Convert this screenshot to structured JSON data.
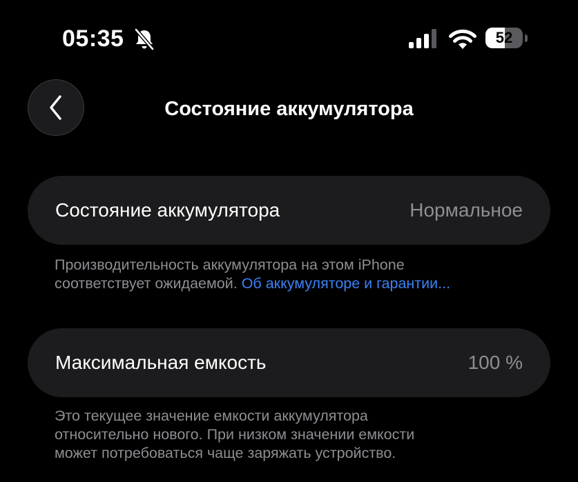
{
  "status_bar": {
    "time": "05:35",
    "battery_percent": "52",
    "battery_level": 0.52,
    "icons": [
      "bell-slash-icon",
      "cellular-signal-icon",
      "wifi-icon",
      "battery-icon"
    ]
  },
  "nav": {
    "title": "Состояние аккумулятора",
    "back_icon": "chevron-left-icon"
  },
  "battery_health": {
    "label": "Состояние аккумулятора",
    "value": "Нормальное",
    "footnote_line1": "Производительность аккумулятора на этом iPhone",
    "footnote_line2": "соответствует ожидаемой.",
    "footnote_link": "Об аккумуляторе и гарантии..."
  },
  "max_capacity": {
    "label": "Максимальная емкость",
    "value": "100 %",
    "footnote_line1": "Это текущее значение емкости аккумулятора",
    "footnote_line2": "относительно нового. При низком значении емкости",
    "footnote_line3": "может потребоваться чаще заряжать устройство."
  },
  "colors": {
    "background": "#000000",
    "cell": "#1c1c1e",
    "secondary_text": "#8e8e93",
    "link": "#3b82f6"
  }
}
